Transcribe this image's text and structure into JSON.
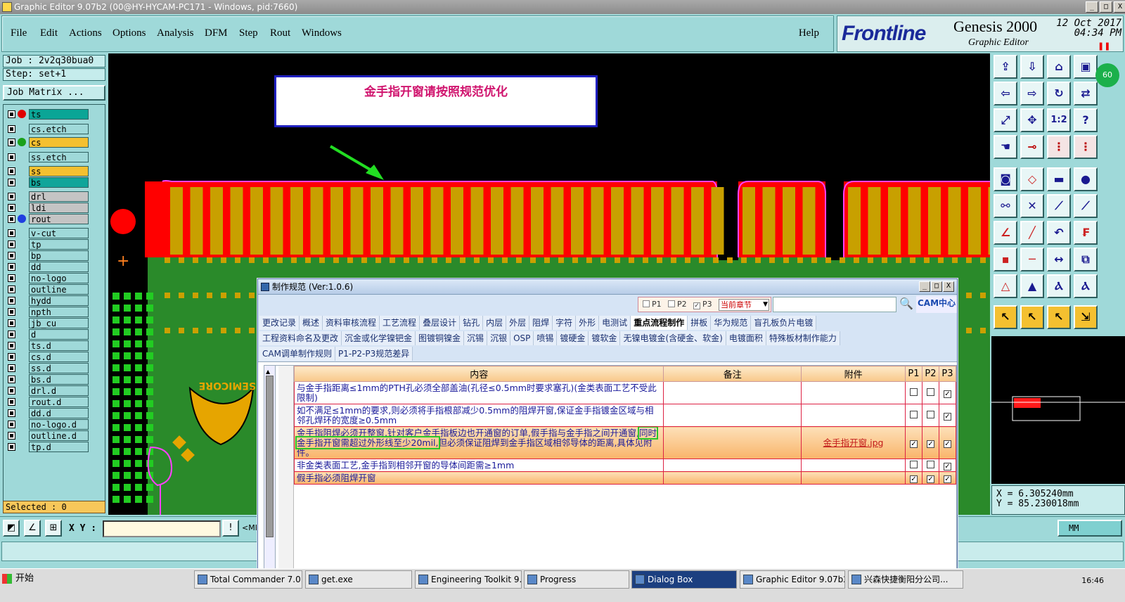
{
  "window": {
    "title": "Graphic Editor 9.07b2 (00@HY-HYCAM-PC171 - Windows, pid:7660)",
    "controls": [
      "_",
      "□",
      "X"
    ]
  },
  "menu": {
    "items": [
      "File",
      "Edit",
      "Actions",
      "Options",
      "Analysis",
      "DFM",
      "Step",
      "Rout",
      "Windows"
    ],
    "help": "Help"
  },
  "brand": {
    "logo": "Frontline",
    "product": "Genesis 2000",
    "subtitle": "Graphic Editor",
    "date": "12 Oct 2017",
    "time": "04:34 PM"
  },
  "job": {
    "job_label": "Job : 2v2q30bua0",
    "step_label": "Step: set+1",
    "matrix_button": "Job Matrix ..."
  },
  "layers": [
    {
      "name": "ts",
      "color": "#0aa596",
      "dot": "#e00000"
    },
    {
      "name": "cs.etch",
      "color": "#9fd9d9",
      "dot": ""
    },
    {
      "name": "cs",
      "color": "#f4c030",
      "dot": "#1aa01a"
    },
    {
      "name": "ss.etch",
      "color": "#9fd9d9",
      "dot": ""
    },
    {
      "name": "ss",
      "color": "#f4c030",
      "dot": ""
    },
    {
      "name": "bs",
      "color": "#10a59a",
      "dot": ""
    },
    {
      "name": "drl",
      "color": "#c4c4c4",
      "dot": ""
    },
    {
      "name": "ldi",
      "color": "#c4c4c4",
      "dot": ""
    },
    {
      "name": "rout",
      "color": "#c4c4c4",
      "dot": "#1f3fe0"
    },
    {
      "name": "v-cut",
      "color": "#9fd9d9",
      "dot": ""
    },
    {
      "name": "tp",
      "color": "#9fd9d9",
      "dot": ""
    },
    {
      "name": "bp",
      "color": "#9fd9d9",
      "dot": ""
    },
    {
      "name": "dd",
      "color": "#9fd9d9",
      "dot": ""
    },
    {
      "name": "no-logo",
      "color": "#9fd9d9",
      "dot": ""
    },
    {
      "name": "outline",
      "color": "#9fd9d9",
      "dot": ""
    },
    {
      "name": "hydd",
      "color": "#9fd9d9",
      "dot": ""
    },
    {
      "name": "npth",
      "color": "#9fd9d9",
      "dot": ""
    },
    {
      "name": "jb_cu",
      "color": "#9fd9d9",
      "dot": ""
    },
    {
      "name": "d",
      "color": "#9fd9d9",
      "dot": ""
    },
    {
      "name": "ts.d",
      "color": "#9fd9d9",
      "dot": ""
    },
    {
      "name": "cs.d",
      "color": "#9fd9d9",
      "dot": ""
    },
    {
      "name": "ss.d",
      "color": "#9fd9d9",
      "dot": ""
    },
    {
      "name": "bs.d",
      "color": "#9fd9d9",
      "dot": ""
    },
    {
      "name": "drl.d",
      "color": "#9fd9d9",
      "dot": ""
    },
    {
      "name": "rout.d",
      "color": "#9fd9d9",
      "dot": ""
    },
    {
      "name": "dd.d",
      "color": "#9fd9d9",
      "dot": ""
    },
    {
      "name": "no-logo.d",
      "color": "#9fd9d9",
      "dot": ""
    },
    {
      "name": "outline.d",
      "color": "#9fd9d9",
      "dot": ""
    },
    {
      "name": "tp.d",
      "color": "#9fd9d9",
      "dot": ""
    }
  ],
  "selected_label": "Selected : 0",
  "canvas": {
    "banner": "金手指开窗请按照规范优化",
    "logo_text": "SEMICORE"
  },
  "tools": {
    "badge": "60",
    "ratio_label": "1:2"
  },
  "coords": {
    "x": "X = 6.305240mm",
    "y": "Y = 85.230018mm"
  },
  "bottombar": {
    "xy_label": "X Y :",
    "xy_value": "",
    "truncated": "<MI",
    "units": "MM"
  },
  "dialog": {
    "title": "制作规范 (Ver:1.0.6)",
    "filters": [
      {
        "label": "P1",
        "checked": false
      },
      {
        "label": "P2",
        "checked": false
      },
      {
        "label": "P3",
        "checked": true
      }
    ],
    "chapter_select": "当前章节",
    "search_value": "",
    "cam_center": "CAM中心",
    "tabs_row1": [
      "更改记录",
      "概述",
      "资料审核流程",
      "工艺流程",
      "叠层设计",
      "钻孔",
      "内层",
      "外层",
      "阻焊",
      "字符",
      "外形",
      "电测试",
      "重点流程制作",
      "拼板",
      "华为规范",
      "盲孔板负片电镀"
    ],
    "active_tab": "重点流程制作",
    "tabs_row2": [
      "工程资料命名及更改",
      "沉金或化学镍钯金",
      "图镀铜镍金",
      "沉锡",
      "沉银",
      "OSP",
      "喷锡",
      "镀硬金",
      "镀软金",
      "无镍电镀金(含硬金、软金)",
      "电镀面积",
      "特殊板材制作能力"
    ],
    "tabs_row3": [
      "CAM调单制作规则",
      "P1-P2-P3规范差异"
    ],
    "columns": [
      "内容",
      "备注",
      "附件",
      "P1",
      "P2",
      "P3"
    ],
    "rows": [
      {
        "content": "与金手指距离≤1mm的PTH孔必须全部盖油(孔径≤0.5mm时要求塞孔)(金类表面工艺不受此限制)",
        "note": "",
        "attachment": "",
        "p1": false,
        "p2": false,
        "p3": true,
        "highlight": false
      },
      {
        "content": "如不满足≤1mm的要求,则必须将手指根部减少0.5mm的阻焊开窗,保证金手指镀金区域与相邻孔焊环的宽度≥0.5mm",
        "note": "",
        "attachment": "",
        "p1": false,
        "p2": false,
        "p3": true,
        "highlight": false
      },
      {
        "content_pre": "金手指阻焊必须开整窗,针对客户金手指板边也开通窗的订单,假手指与金手指之间开通窗,",
        "content_mark": "同时金手指开窗需超过外形线至少20mil,",
        "content_post": "但必须保证阻焊到金手指区域相邻导体的距离,具体见附件。",
        "note": "",
        "attachment": "金手指开窗.jpg",
        "p1": true,
        "p2": true,
        "p3": true,
        "highlight": true
      },
      {
        "content": "非金类表面工艺,金手指到相邻开窗的导体间距需≥1mm",
        "note": "",
        "attachment": "",
        "p1": false,
        "p2": false,
        "p3": true,
        "highlight": false
      },
      {
        "content": "假手指必须阻焊开窗",
        "note": "",
        "attachment": "",
        "p1": true,
        "p2": true,
        "p3": true,
        "highlight": true
      }
    ]
  },
  "taskbar": {
    "start": "开始",
    "tasks": [
      "Total Commander 7.0 p...",
      "get.exe",
      "Engineering Toolkit 9.07...",
      "Progress",
      "Dialog Box",
      "Graphic Editor 9.07b2 (...",
      "兴森快捷衡阳分公司..."
    ],
    "active_task": "Dialog Box",
    "clock": "16:46"
  }
}
